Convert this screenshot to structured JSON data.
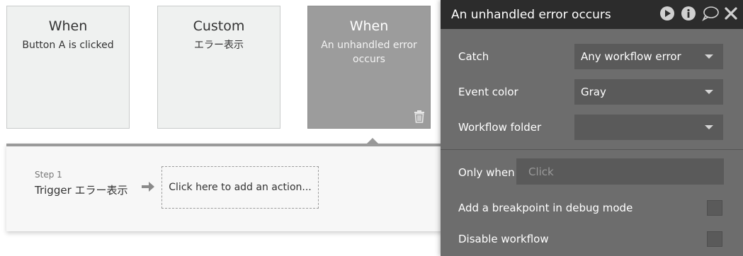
{
  "cards": [
    {
      "title": "When",
      "subtitle": "Button A is clicked"
    },
    {
      "title": "Custom",
      "subtitle": "エラー表示"
    },
    {
      "title": "When",
      "subtitle": "An unhandled error occurs"
    }
  ],
  "workflow": {
    "step_label": "Step 1",
    "step_title": "Trigger エラー表示",
    "add_action": "Click here to add an action..."
  },
  "editor": {
    "title": "An unhandled error occurs",
    "header_icons": [
      "play-icon",
      "info-icon",
      "comment-icon",
      "close-icon"
    ],
    "catch_label": "Catch",
    "catch_value": "Any workflow error",
    "event_color_label": "Event color",
    "event_color_value": "Gray",
    "folder_label": "Workflow folder",
    "folder_value": "",
    "only_when_label": "Only when",
    "only_when_placeholder": "Click",
    "breakpoint_label": "Add a breakpoint in debug mode",
    "breakpoint_checked": false,
    "disable_label": "Disable workflow",
    "disable_checked": false
  },
  "colors": {
    "active_card": "#9c9c9c",
    "editor_bg": "#6d6d6d",
    "editor_header": "#2c2c2c"
  }
}
